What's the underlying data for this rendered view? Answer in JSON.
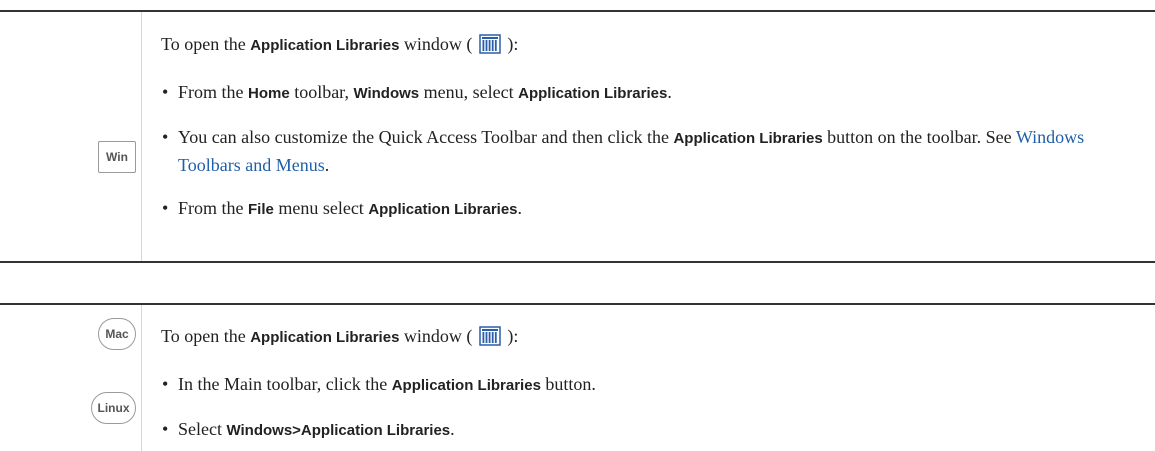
{
  "win_block": {
    "badge": "Win",
    "intro": {
      "pre": "To open the ",
      "bold": "Application Libraries",
      "post1": " window ( ",
      "icon": "application-libraries-icon",
      "post2": " ):"
    },
    "items": [
      {
        "t1": "From the ",
        "b1": "Home",
        "t2": " toolbar, ",
        "b2": "Windows",
        "t3": " menu, select ",
        "b3": "Application Libraries",
        "t4": "."
      },
      {
        "t1": "You can also customize the Quick Access Toolbar and then click the ",
        "b1": "Application Libraries",
        "t2": " button on the toolbar. See ",
        "link": "Windows Toolbars and Menus",
        "t3": "."
      },
      {
        "t1": "From the ",
        "b1": "File",
        "t2": " menu select ",
        "b2": "Application Libraries",
        "t3": "."
      }
    ]
  },
  "mac_linux_block": {
    "badges": [
      "Mac",
      "Linux"
    ],
    "intro": {
      "pre": "To open the ",
      "bold": "Application Libraries",
      "post1": " window ( ",
      "icon": "application-libraries-icon",
      "post2": " ):"
    },
    "items": [
      {
        "t1": "In the Main toolbar, click the ",
        "b1": "Application Libraries",
        "t2": " button."
      },
      {
        "t1": "Select ",
        "b1": "Windows>Application Libraries",
        "t2": "."
      }
    ]
  },
  "bullet": "•",
  "colors": {
    "link": "#1f5fa8",
    "icon": "#2a5ea8"
  }
}
